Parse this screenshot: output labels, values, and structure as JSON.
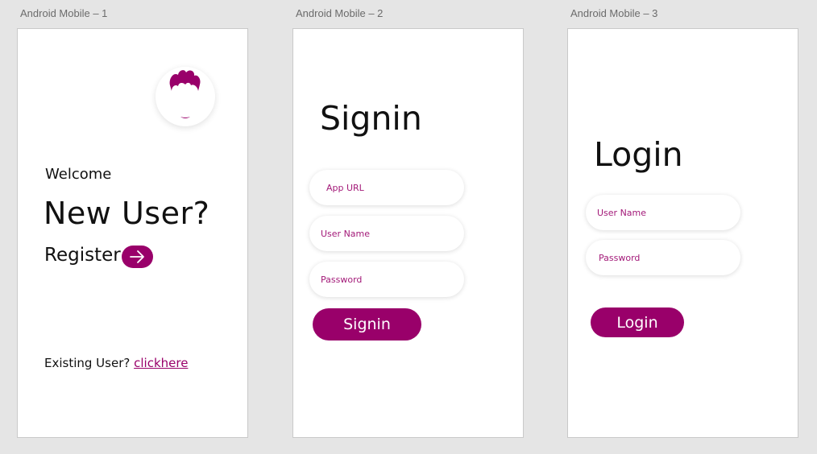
{
  "colors": {
    "accent": "#99006a",
    "canvas": "#e5e5e5",
    "artboard": "#ffffff"
  },
  "artboards": [
    {
      "label": "Android Mobile – 1",
      "welcome": "Welcome",
      "headline": "New User?",
      "register_label": "Register",
      "register_icon": "arrow-right-icon",
      "avatar_icon": "user-avatar-icon",
      "existing_prefix": "Existing User? ",
      "existing_link": "clickhere"
    },
    {
      "label": "Android Mobile – 2",
      "title": "Signin",
      "fields": [
        {
          "placeholder": "App URL"
        },
        {
          "placeholder": "User Name"
        },
        {
          "placeholder": "Password"
        }
      ],
      "button_label": "Signin"
    },
    {
      "label": "Android Mobile – 3",
      "title": "Login",
      "fields": [
        {
          "placeholder": "User Name"
        },
        {
          "placeholder": "Password"
        }
      ],
      "button_label": "Login"
    }
  ]
}
